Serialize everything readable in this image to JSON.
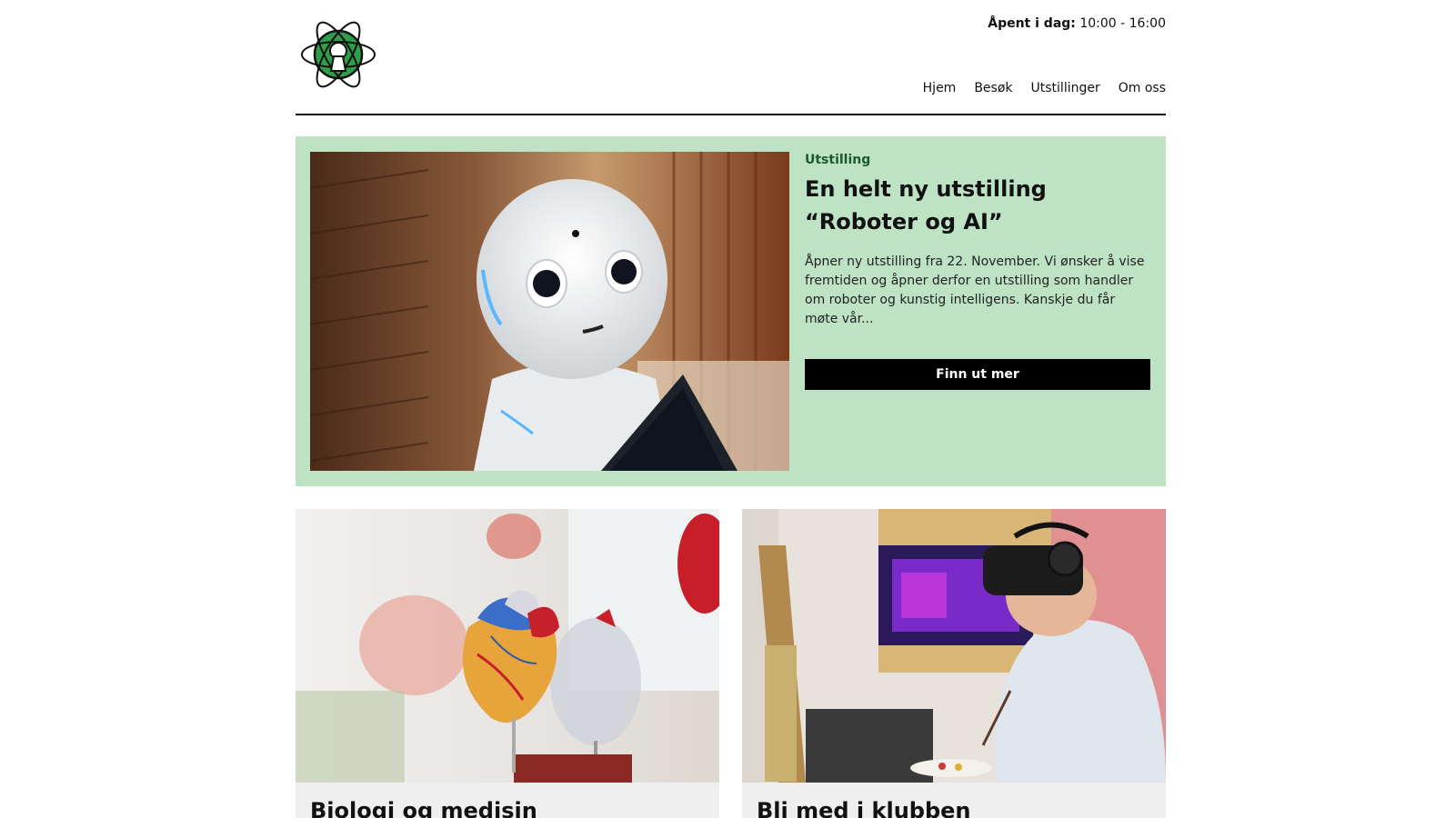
{
  "header": {
    "logo_alt": "Vitensenter logo",
    "hours_label": "Åpent i dag:",
    "hours_value": "10:00 - 16:00",
    "nav": [
      "Hjem",
      "Besøk",
      "Utstillinger",
      "Om oss"
    ]
  },
  "hero": {
    "eyebrow": "Utstilling",
    "title_line1": "En helt ny utstilling",
    "title_line2": "“Roboter og AI”",
    "description": "Åpner ny utstilling fra 22. November. Vi ønsker å vise fremtiden og åpner derfor en utstilling som handler om roboter og kunstig intelligens. Kanskje du får møte vår...",
    "cta_label": "Finn ut mer"
  },
  "cards": [
    {
      "title": "Biologi og medisin"
    },
    {
      "title": "Bli med i klubben"
    }
  ],
  "colors": {
    "hero_bg": "#bde2c4",
    "eyebrow": "#1f5a2c",
    "card_bg": "#efefef",
    "logo_green": "#2e9e4a"
  },
  "icons": {
    "logo": "atom-keyhole-logo"
  }
}
